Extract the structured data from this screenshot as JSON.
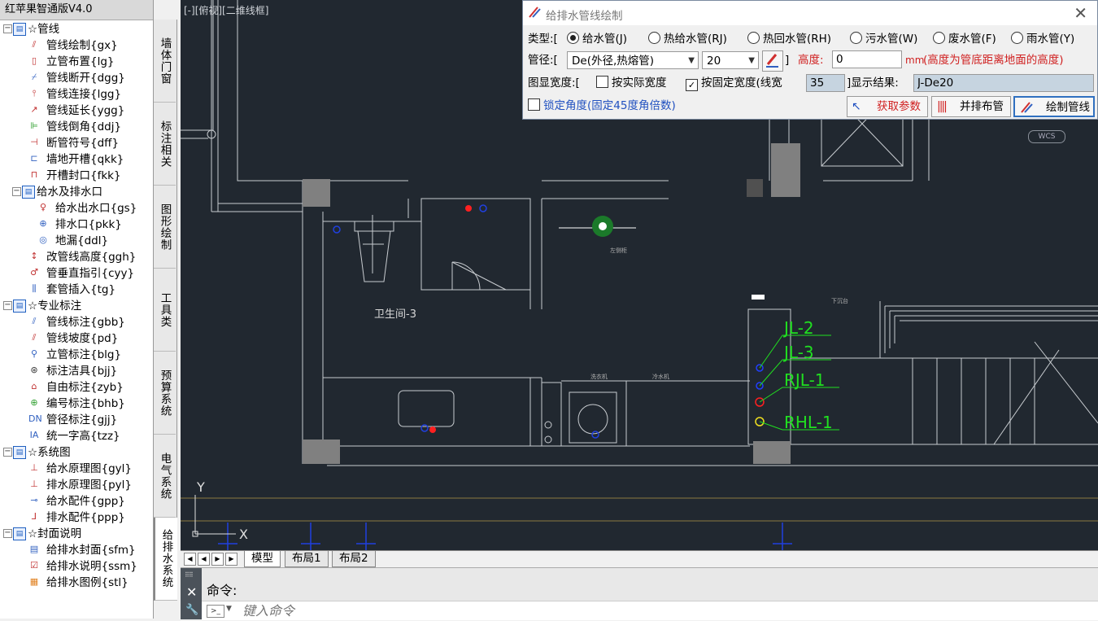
{
  "sidebar": {
    "title": "红苹果智通版V4.0",
    "items": [
      {
        "label": "☆管线",
        "level": 0,
        "folder": true,
        "icon": "folder-icon"
      },
      {
        "label": "管线绘制{gx}",
        "level": 1,
        "icon": "pipe-draw-icon",
        "color": "#c03030",
        "glyph": "⫽"
      },
      {
        "label": "立管布置{lg}",
        "level": 1,
        "icon": "riser-icon",
        "color": "#c03030",
        "glyph": "▯"
      },
      {
        "label": "管线断开{dgg}",
        "level": 1,
        "icon": "pipe-break-icon",
        "color": "#3060c0",
        "glyph": "⌿"
      },
      {
        "label": "管线连接{lgg}",
        "level": 1,
        "icon": "pipe-connect-icon",
        "color": "#c03030",
        "glyph": "⫯"
      },
      {
        "label": "管线延长{ygg}",
        "level": 1,
        "icon": "pipe-extend-icon",
        "color": "#c03030",
        "glyph": "↗"
      },
      {
        "label": "管线倒角{ddj}",
        "level": 1,
        "icon": "pipe-chamfer-icon",
        "color": "#30a030",
        "glyph": "⊫"
      },
      {
        "label": "断管符号{dff}",
        "level": 1,
        "icon": "break-symbol-icon",
        "color": "#c03030",
        "glyph": "⊣"
      },
      {
        "label": "墙地开槽{qkk}",
        "level": 1,
        "icon": "wall-slot-icon",
        "color": "#3060c0",
        "glyph": "⊏"
      },
      {
        "label": "开槽封口{fkk}",
        "level": 1,
        "icon": "slot-seal-icon",
        "color": "#c03030",
        "glyph": "⊓"
      },
      {
        "label": "给水及排水口",
        "level": 1,
        "folder": true,
        "icon": "folder-icon"
      },
      {
        "label": "给水出水口{gs}",
        "level": 2,
        "icon": "water-outlet-icon",
        "color": "#c03030",
        "glyph": "♀"
      },
      {
        "label": "排水口{pkk}",
        "level": 2,
        "icon": "drain-outlet-icon",
        "color": "#3060c0",
        "glyph": "⊕"
      },
      {
        "label": "地漏{ddl}",
        "level": 2,
        "icon": "floor-drain-icon",
        "color": "#3060c0",
        "glyph": "◎"
      },
      {
        "label": "改管线高度{ggh}",
        "level": 1,
        "icon": "pipe-height-icon",
        "color": "#c03030",
        "glyph": "↕"
      },
      {
        "label": "管垂直指引{cyy}",
        "level": 1,
        "icon": "vertical-guide-icon",
        "color": "#c03030",
        "glyph": "♂"
      },
      {
        "label": "套管插入{tg}",
        "level": 1,
        "icon": "sleeve-insert-icon",
        "color": "#3060c0",
        "glyph": "⫼"
      },
      {
        "label": "☆专业标注",
        "level": 0,
        "folder": true,
        "icon": "folder-icon"
      },
      {
        "label": "管线标注{gbb}",
        "level": 1,
        "icon": "pipe-label-icon",
        "color": "#3060c0",
        "glyph": "⫽"
      },
      {
        "label": "管线坡度{pd}",
        "level": 1,
        "icon": "pipe-slope-icon",
        "color": "#c03030",
        "glyph": "⫽"
      },
      {
        "label": "立管标注{blg}",
        "level": 1,
        "icon": "riser-label-icon",
        "color": "#3060c0",
        "glyph": "⚲"
      },
      {
        "label": "标注洁具{bjj}",
        "level": 1,
        "icon": "fixture-label-icon",
        "color": "#333333",
        "glyph": "⊛"
      },
      {
        "label": "自由标注{zyb}",
        "level": 1,
        "icon": "free-label-icon",
        "color": "#c03030",
        "glyph": "⌂"
      },
      {
        "label": "编号标注{bhb}",
        "level": 1,
        "icon": "number-label-icon",
        "color": "#30a030",
        "glyph": "⊕"
      },
      {
        "label": "管径标注{gjj}",
        "level": 1,
        "icon": "diameter-label-icon",
        "color": "#3060c0",
        "glyph": "DN"
      },
      {
        "label": "统一字高{tzz}",
        "level": 1,
        "icon": "text-height-icon",
        "color": "#3060c0",
        "glyph": "IA"
      },
      {
        "label": "☆系统图",
        "level": 0,
        "folder": true,
        "icon": "folder-icon"
      },
      {
        "label": "给水原理图{gyl}",
        "level": 1,
        "icon": "supply-schematic-icon",
        "color": "#c03030",
        "glyph": "⊥"
      },
      {
        "label": "排水原理图{pyl}",
        "level": 1,
        "icon": "drain-schematic-icon",
        "color": "#c03030",
        "glyph": "⊥"
      },
      {
        "label": "给水配件{gpp}",
        "level": 1,
        "icon": "supply-fitting-icon",
        "color": "#3060c0",
        "glyph": "⊸"
      },
      {
        "label": "排水配件{ppp}",
        "level": 1,
        "icon": "drain-fitting-icon",
        "color": "#c03030",
        "glyph": "⅃"
      },
      {
        "label": "☆封面说明",
        "level": 0,
        "folder": true,
        "icon": "folder-icon"
      },
      {
        "label": "给排水封面{sfm}",
        "level": 1,
        "icon": "cover-icon",
        "color": "#3060c0",
        "glyph": "▤"
      },
      {
        "label": "给排水说明{ssm}",
        "level": 1,
        "icon": "description-icon",
        "color": "#c03030",
        "glyph": "☑"
      },
      {
        "label": "给排水图例{stl}",
        "level": 1,
        "icon": "legend-icon",
        "color": "#e08020",
        "glyph": "▦"
      }
    ]
  },
  "vtabs": [
    "墙体门窗",
    "标注相关",
    "图形绘制",
    "工具类",
    "预算系统",
    "电气系统",
    "给排水系统"
  ],
  "canvas": {
    "view_label": "[-][俯视][二维线框]",
    "wcs": "WCS",
    "room_label": "卫生间-3",
    "riser_labels": [
      "JL-2",
      "JL-3",
      "RJL-1",
      "RHL-1"
    ],
    "axis_y": "Y",
    "axis_x": "X",
    "small_labels": [
      "左侧柜",
      "下沉台",
      "洗衣机",
      "冷水机"
    ]
  },
  "layout_tabs": [
    "模型",
    "布局1",
    "布局2"
  ],
  "command": {
    "label": "命令:",
    "placeholder": "键入命令"
  },
  "dialog": {
    "title": "给排水管线绘制",
    "type_label": "类型:[",
    "types": [
      "给水管(J)",
      "热给水管(RJ)",
      "热回水管(RH)",
      "污水管(W)",
      "废水管(F)",
      "雨水管(Y)"
    ],
    "selected_type": 0,
    "diameter_label": "管径:[",
    "diameter_type": "De(外径,热熔管)",
    "diameter_value": "20",
    "bracket_close": "]",
    "height_label": "高度:",
    "height_value": "0",
    "height_unit": "mm",
    "height_note": "(高度为管底距离地面的高度)",
    "width_label": "图显宽度:[",
    "actual_width": "按实际宽度",
    "actual_width_checked": false,
    "fixed_width": "按固定宽度(线宽",
    "fixed_width_checked": true,
    "fixed_width_value": "35",
    "display_result_label": "]显示结果:",
    "display_result": "J-De20",
    "lock_angle": "锁定角度(固定45度角倍数)",
    "lock_angle_checked": false,
    "get_params": "获取参数",
    "parallel": "并排布管",
    "draw": "绘制管线"
  }
}
